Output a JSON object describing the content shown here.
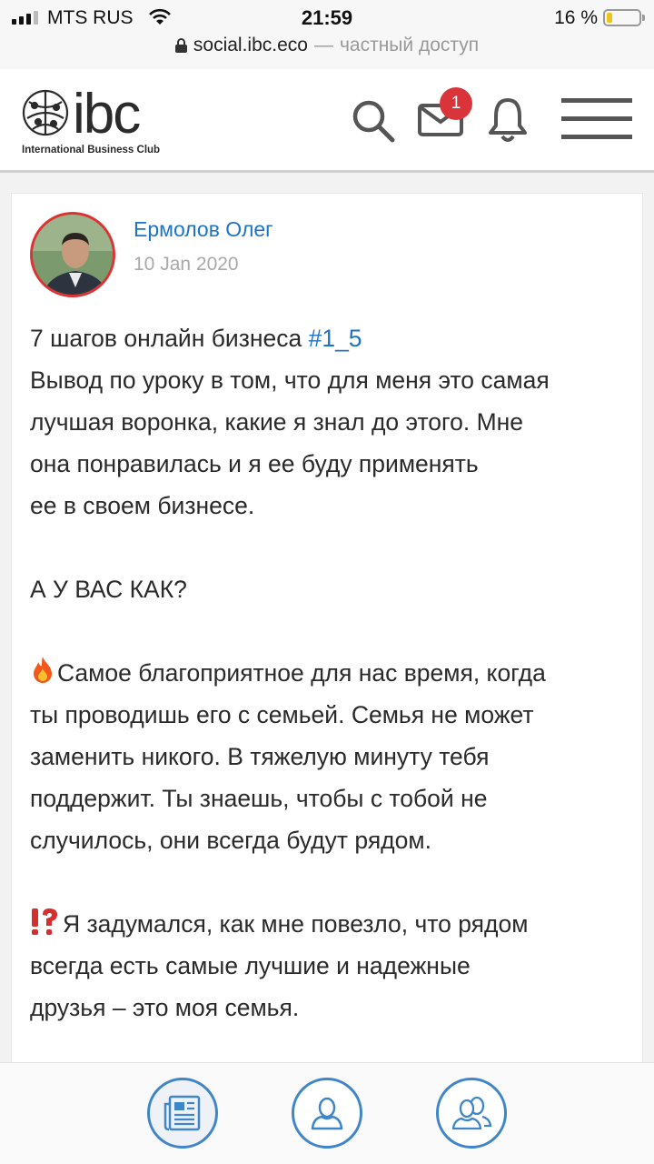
{
  "status_bar": {
    "carrier": "MTS RUS",
    "time": "21:59",
    "battery_percent": "16 %"
  },
  "address_bar": {
    "domain": "social.ibc.eco",
    "separator": "—",
    "access": "частный доступ"
  },
  "header": {
    "logo_text": "ibc",
    "logo_subtitle": "International Business Club",
    "messages_badge": "1",
    "icons": [
      "search-icon",
      "mail-icon",
      "bell-icon",
      "menu-icon"
    ]
  },
  "post": {
    "author": "Ермолов Олег",
    "date": "10 Jan 2020",
    "line1_text": "7 шагов онлайн бизнеса ",
    "hashtag": "#1_5",
    "lines_a": [
      "Вывод по уроку в том, что для меня это самая",
      "лучшая воронка, какие я знал до этого. Мне",
      "она понравилась и я ее буду применять",
      "ее в своем бизнесе."
    ],
    "question": "А У ВАС КАК?",
    "fire_first": "Самое благоприятное для нас время, когда",
    "lines_b": [
      "ты проводишь его с семьей. Семья не может",
      "заменить никого. В тяжелую минуту тебя",
      "поддержит. Ты знаешь, чтобы с тобой не",
      "случилось, они всегда будут рядом."
    ],
    "interrobang_first": "Я задумался, как мне повезло, что рядом",
    "lines_c": [
      "всегда есть самые лучшие и надежные",
      "друзья – это моя семья."
    ]
  },
  "bottom_nav": [
    {
      "name": "feed",
      "icon": "newspaper-icon",
      "active": true
    },
    {
      "name": "profile",
      "icon": "user-icon",
      "active": false
    },
    {
      "name": "friends",
      "icon": "users-icon",
      "active": false
    }
  ],
  "colors": {
    "accent": "#1f73c6",
    "badge": "#d9343a",
    "nav_ring": "#3f86c9",
    "date_grey": "#a9a9a9"
  }
}
